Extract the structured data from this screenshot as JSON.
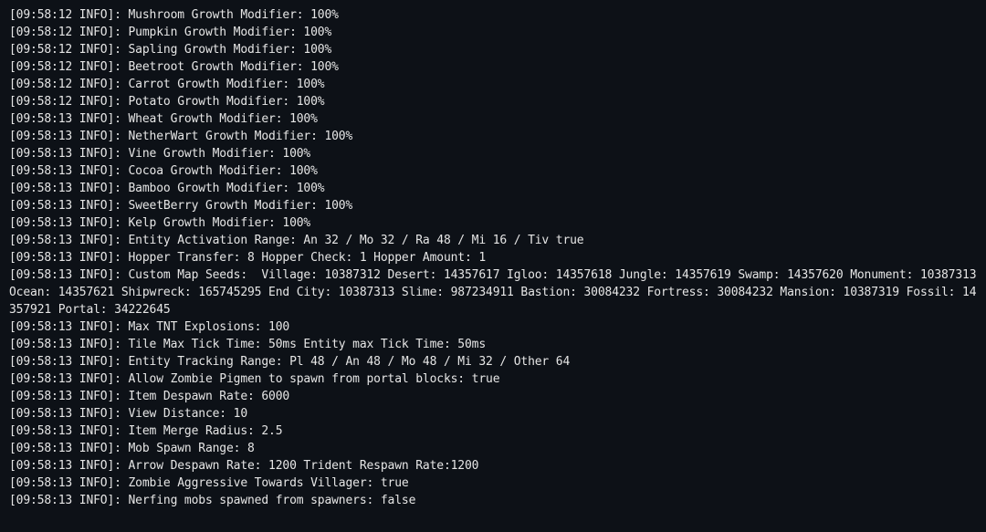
{
  "console": {
    "lines": [
      "[09:58:12 INFO]: Mushroom Growth Modifier: 100%",
      "[09:58:12 INFO]: Pumpkin Growth Modifier: 100%",
      "[09:58:12 INFO]: Sapling Growth Modifier: 100%",
      "[09:58:12 INFO]: Beetroot Growth Modifier: 100%",
      "[09:58:12 INFO]: Carrot Growth Modifier: 100%",
      "[09:58:12 INFO]: Potato Growth Modifier: 100%",
      "[09:58:13 INFO]: Wheat Growth Modifier: 100%",
      "[09:58:13 INFO]: NetherWart Growth Modifier: 100%",
      "[09:58:13 INFO]: Vine Growth Modifier: 100%",
      "[09:58:13 INFO]: Cocoa Growth Modifier: 100%",
      "[09:58:13 INFO]: Bamboo Growth Modifier: 100%",
      "[09:58:13 INFO]: SweetBerry Growth Modifier: 100%",
      "[09:58:13 INFO]: Kelp Growth Modifier: 100%",
      "[09:58:13 INFO]: Entity Activation Range: An 32 / Mo 32 / Ra 48 / Mi 16 / Tiv true",
      "[09:58:13 INFO]: Hopper Transfer: 8 Hopper Check: 1 Hopper Amount: 1",
      "[09:58:13 INFO]: Custom Map Seeds:  Village: 10387312 Desert: 14357617 Igloo: 14357618 Jungle: 14357619 Swamp: 14357620 Monument: 10387313 Ocean: 14357621 Shipwreck: 165745295 End City: 10387313 Slime: 987234911 Bastion: 30084232 Fortress: 30084232 Mansion: 10387319 Fossil: 14357921 Portal: 34222645",
      "[09:58:13 INFO]: Max TNT Explosions: 100",
      "[09:58:13 INFO]: Tile Max Tick Time: 50ms Entity max Tick Time: 50ms",
      "[09:58:13 INFO]: Entity Tracking Range: Pl 48 / An 48 / Mo 48 / Mi 32 / Other 64",
      "[09:58:13 INFO]: Allow Zombie Pigmen to spawn from portal blocks: true",
      "[09:58:13 INFO]: Item Despawn Rate: 6000",
      "[09:58:13 INFO]: View Distance: 10",
      "[09:58:13 INFO]: Item Merge Radius: 2.5",
      "[09:58:13 INFO]: Mob Spawn Range: 8",
      "[09:58:13 INFO]: Arrow Despawn Rate: 1200 Trident Respawn Rate:1200",
      "[09:58:13 INFO]: Zombie Aggressive Towards Villager: true",
      "[09:58:13 INFO]: Nerfing mobs spawned from spawners: false"
    ]
  }
}
